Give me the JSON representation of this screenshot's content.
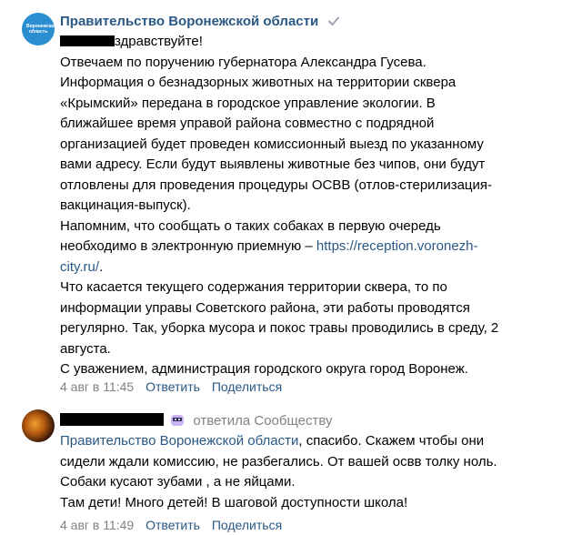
{
  "comment1": {
    "author": "Правительство Воронежской области",
    "avatar_text": "Воронежская область",
    "greeting_suffix": "здравствуйте!",
    "lines": [
      "Отвечаем по поручению губернатора Александра Гусева.",
      "Информация о безнадзорных животных на территории сквера",
      "«Крымский» передана в городское управление экологии. В",
      "ближайшее время управой района совместно с подрядной",
      "организацией будет проведен комиссионный выезд по указанному",
      "вами адресу. Если будут выявлены животные без чипов, они будут",
      "отловлены для проведения процедуры ОСВВ (отлов-стерилизация-",
      "вакцинация-выпуск).",
      "Напомним, что сообщать о таких собаках в первую очередь"
    ],
    "link_prefix": "необходимо в электронную приемную – ",
    "link_text_part1": "https://reception.voronezh-",
    "link_text_part2": "city.ru/",
    "link_suffix": ".",
    "lines_after": [
      "Что касается текущего содержания территории сквера, то по",
      "информации управы Советского района, эти работы проводятся",
      "регулярно. Так, уборка мусора и покос травы проводились в среду, 2",
      "августа.",
      "С уважением, администрация городского округа город Воронеж."
    ],
    "date": "4 авг в 11:45",
    "reply_label": "Ответить",
    "share_label": "Поделиться"
  },
  "comment2": {
    "replied_text": "ответила Сообществу",
    "mention": "Правительство Воронежской области",
    "first_line_rest": ", спасибо. Скажем чтобы они",
    "lines": [
      "сидели ждали комиссию, не разбегались. От вашей освв толку ноль.",
      "Собаки кусают зубами , а не яйцами.",
      "Там дети! Много детей! В шаговой доступности школа!"
    ],
    "date": "4 авг в 11:49",
    "reply_label": "Ответить",
    "share_label": "Поделиться"
  },
  "colors": {
    "link": "#2a5885",
    "meta": "#828282",
    "verified": "#99a2ad",
    "gov_avatar": "#2a8ed0"
  }
}
